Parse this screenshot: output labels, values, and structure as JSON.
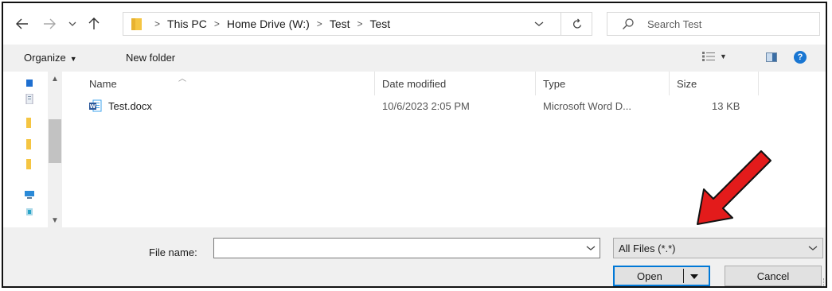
{
  "window": {
    "frame_color": "#111111"
  },
  "nav": {
    "back_icon": "arrow-left-icon",
    "forward_icon": "arrow-right-icon",
    "recent_icon": "chevron-down-icon",
    "up_icon": "arrow-up-icon"
  },
  "address": {
    "crumbs": [
      "This PC",
      "Home Drive (W:)",
      "Test",
      "Test"
    ],
    "separator": ">"
  },
  "search": {
    "placeholder": "Search Test"
  },
  "toolbar": {
    "organize_label": "Organize",
    "new_folder_label": "New folder",
    "help_label": "?"
  },
  "columns": {
    "name": "Name",
    "date_modified": "Date modified",
    "type": "Type",
    "size": "Size"
  },
  "files": [
    {
      "name": "Test.docx",
      "date_modified": "10/6/2023 2:05 PM",
      "type": "Microsoft Word D...",
      "size": "13 KB",
      "icon": "word-document-icon"
    }
  ],
  "footer": {
    "file_name_label": "File name:",
    "file_name_value": "",
    "file_type_value": "All Files (*.*)",
    "open_label": "Open",
    "cancel_label": "Cancel"
  },
  "colors": {
    "accent": "#0078d7",
    "annotation_arrow": "#e31b1b",
    "toolbar_bg": "#f0f0f0",
    "help": "#1976d2"
  }
}
